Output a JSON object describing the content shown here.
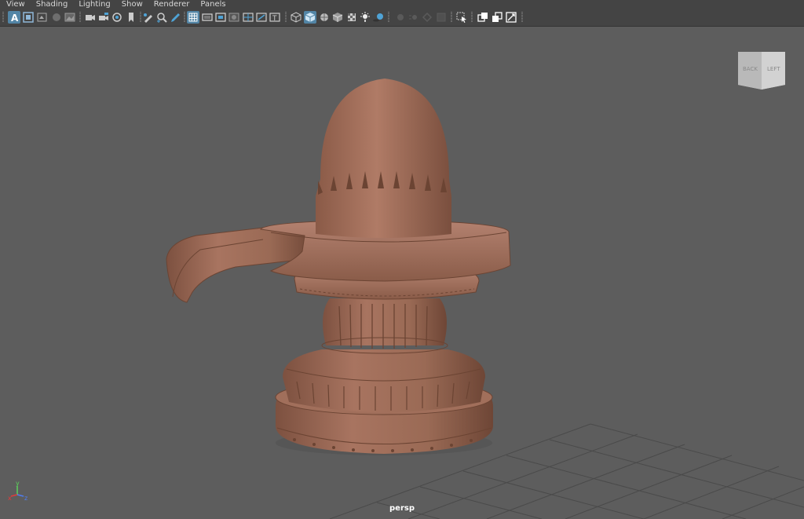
{
  "menu": [
    {
      "label": "View"
    },
    {
      "label": "Shading"
    },
    {
      "label": "Lighting"
    },
    {
      "label": "Show"
    },
    {
      "label": "Renderer"
    },
    {
      "label": "Panels"
    }
  ],
  "viewport": {
    "camera_label": "persp",
    "view_cube": {
      "back": "BACK",
      "left": "LEFT"
    },
    "axis": {
      "x": "x",
      "y": "y",
      "z": "z"
    }
  },
  "colors": {
    "accent": "#5285a6",
    "viewport_bg": "#5d5d5d",
    "model": "#a87460",
    "axis_x": "#e23b3b",
    "axis_y": "#5bd15b",
    "axis_z": "#4f7df0"
  }
}
